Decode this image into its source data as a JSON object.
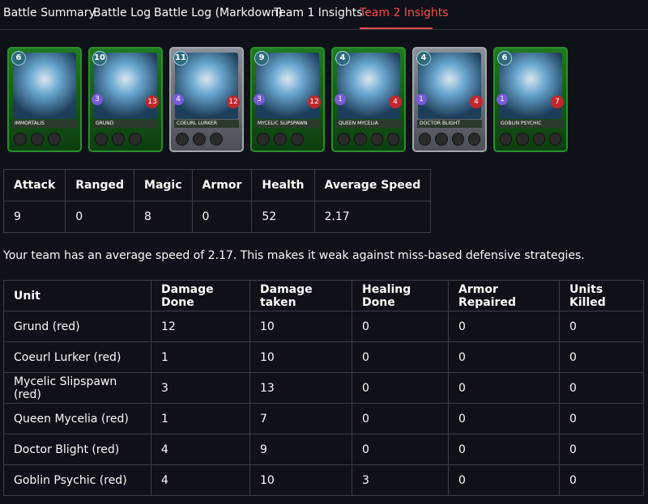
{
  "tabs": [
    {
      "label": "Battle Summary"
    },
    {
      "label": "Battle Log"
    },
    {
      "label": "Battle Log (Markdown)"
    },
    {
      "label": "Team 1 Insights"
    },
    {
      "label": "Team 2 Insights",
      "active": true
    }
  ],
  "cards": [
    {
      "name": "IMMORTALIS",
      "mana": "6",
      "stat": "",
      "speed": "",
      "health": "",
      "frame": "green",
      "element": "green"
    },
    {
      "name": "GRUND",
      "mana": "10",
      "stat": "3",
      "speed": "",
      "health": "13",
      "frame": "green",
      "element": "green"
    },
    {
      "name": "COEURL LURKER",
      "mana": "11",
      "stat": "4",
      "speed": "",
      "health": "12",
      "frame": "gray",
      "element": "green"
    },
    {
      "name": "MYCELIC SLIPSPAWN",
      "mana": "9",
      "stat": "3",
      "speed": "",
      "health": "12",
      "frame": "green",
      "element": "green"
    },
    {
      "name": "QUEEN MYCELIA",
      "mana": "4",
      "stat": "1",
      "speed": "",
      "health": "4",
      "frame": "green",
      "element": "green"
    },
    {
      "name": "DOCTOR BLIGHT",
      "mana": "4",
      "stat": "1",
      "speed": "",
      "health": "4",
      "frame": "gray",
      "element": "green"
    },
    {
      "name": "GOBLIN PSYCHIC",
      "mana": "6",
      "stat": "1",
      "speed": "",
      "health": "7",
      "frame": "green",
      "element": "green"
    }
  ],
  "stats_table": {
    "headers": [
      "Attack",
      "Ranged",
      "Magic",
      "Armor",
      "Health",
      "Average Speed"
    ],
    "values": [
      "9",
      "0",
      "8",
      "0",
      "52",
      "2.17"
    ]
  },
  "summary_text": "Your team has an average speed of 2.17. This makes it weak against miss-based defensive strategies.",
  "units_table": {
    "headers": [
      "Unit",
      "Damage Done",
      "Damage taken",
      "Healing Done",
      "Armor Repaired",
      "Units Killed"
    ],
    "rows": [
      [
        "Grund (red)",
        "12",
        "10",
        "0",
        "0",
        "0"
      ],
      [
        "Coeurl Lurker (red)",
        "1",
        "10",
        "0",
        "0",
        "0"
      ],
      [
        "Mycelic Slipspawn (red)",
        "3",
        "13",
        "0",
        "0",
        "0"
      ],
      [
        "Queen Mycelia (red)",
        "1",
        "7",
        "0",
        "0",
        "0"
      ],
      [
        "Doctor Blight (red)",
        "4",
        "9",
        "0",
        "0",
        "0"
      ],
      [
        "Goblin Psychic (red)",
        "4",
        "10",
        "3",
        "0",
        "0"
      ]
    ]
  },
  "colors": {
    "background": "#0e1117",
    "accent": "#ff4b4b",
    "border": "#3c3f4a"
  }
}
